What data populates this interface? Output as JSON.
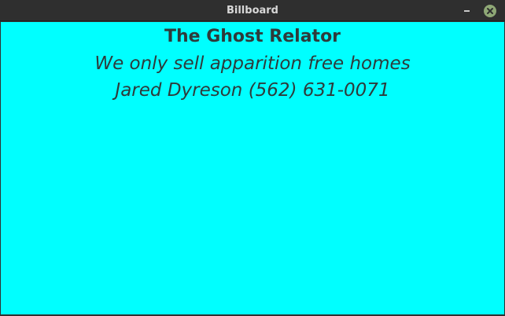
{
  "window": {
    "title": "Billboard"
  },
  "billboard": {
    "headline": "The Ghost Relator",
    "tagline": "We only sell apparition free homes",
    "contact": "Jared Dyreson (562) 631-0071",
    "background_color": "#00ffff",
    "text_color": "#2e3b3b"
  },
  "icons": {
    "minimize": "minimize-icon",
    "close": "close-icon"
  }
}
